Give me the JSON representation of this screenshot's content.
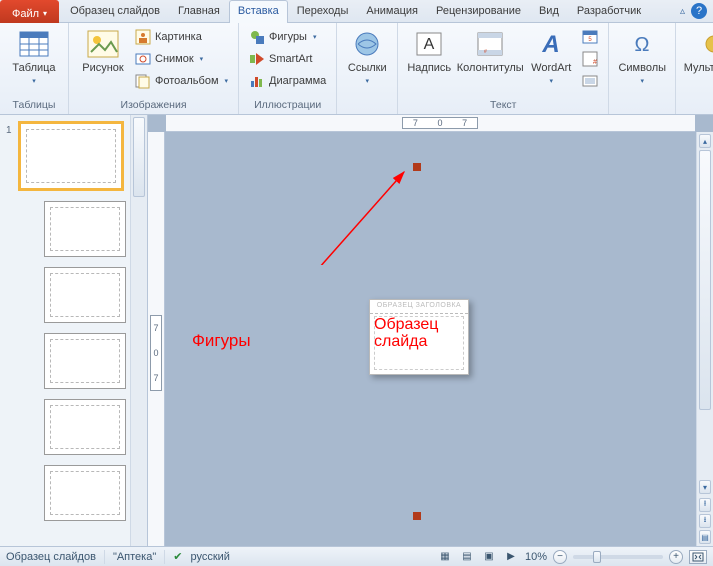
{
  "tabs": {
    "file": "Файл",
    "items": [
      "Образец слайдов",
      "Главная",
      "Вставка",
      "Переходы",
      "Анимация",
      "Рецензирование",
      "Вид",
      "Разработчик"
    ],
    "active_index": 2
  },
  "ribbon": {
    "groups": {
      "tables": {
        "label": "Таблицы",
        "button": "Таблица"
      },
      "images": {
        "label": "Изображения",
        "big": "Рисунок",
        "small": [
          "Картинка",
          "Снимок",
          "Фотоальбом"
        ]
      },
      "illustrations": {
        "label": "Иллюстрации",
        "small": [
          "Фигуры",
          "SmartArt",
          "Диаграмма"
        ]
      },
      "links": {
        "label": "",
        "button": "Ссылки"
      },
      "text": {
        "label": "Текст",
        "big": [
          "Надпись",
          "Колонтитулы",
          "WordArt"
        ]
      },
      "symbols": {
        "label": "",
        "button": "Символы"
      },
      "media": {
        "label": "",
        "button": "Мультимедиа"
      }
    }
  },
  "ruler": {
    "h": [
      "7",
      "0",
      "7"
    ],
    "v": [
      "7",
      "0",
      "7"
    ]
  },
  "thumbs": {
    "master_number": "1"
  },
  "annotations": {
    "shapes": "Фигуры",
    "block_header": "ОБРАЗЕЦ ЗАГОЛОВКА",
    "block_text": "Образец слайда"
  },
  "status": {
    "view": "Образец слайдов",
    "theme": "\"Аптека\"",
    "language": "русский",
    "zoom": "10%"
  }
}
